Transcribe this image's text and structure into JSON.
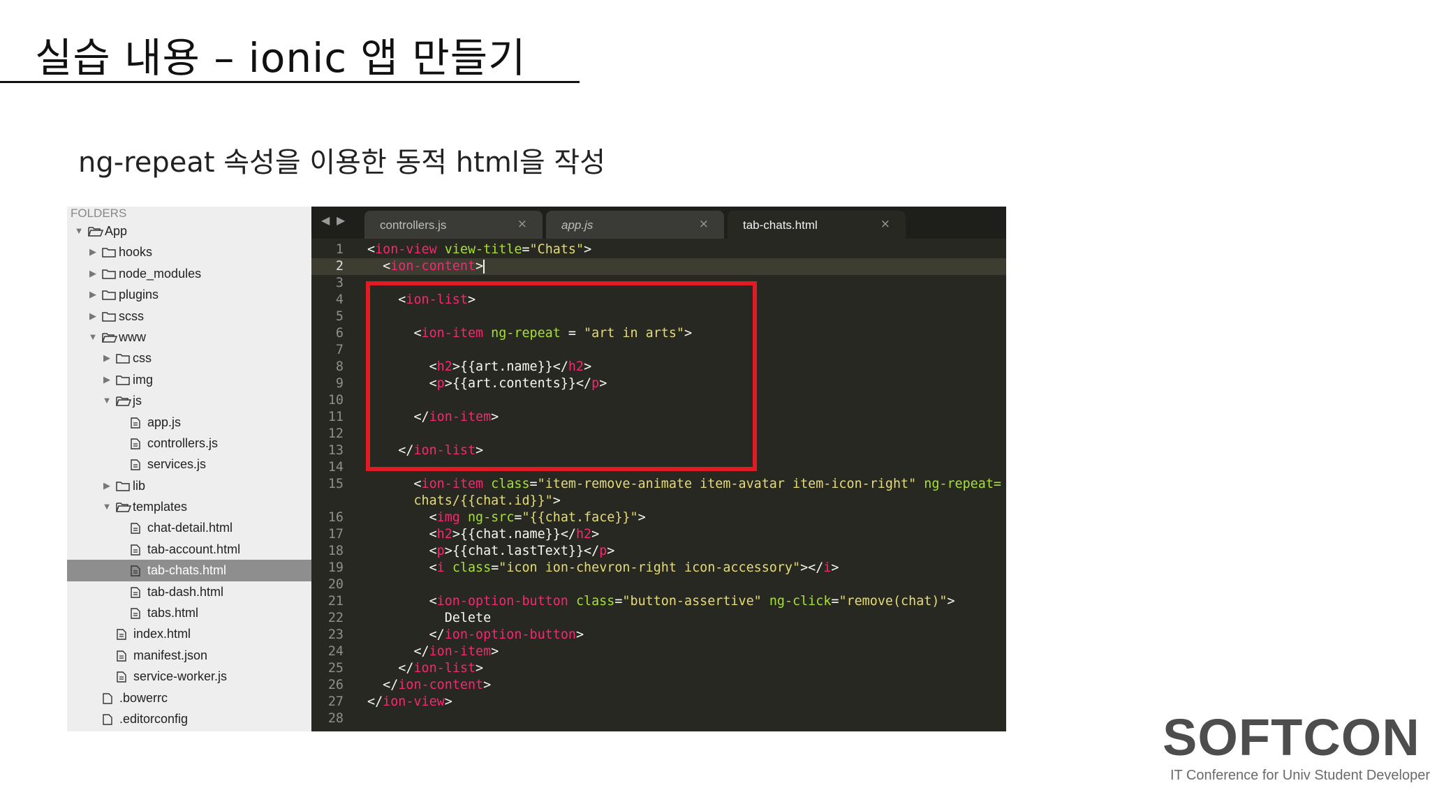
{
  "slide": {
    "title": "실습 내용 – ionic 앱 만들기",
    "subtitle": "ng-repeat 속성을 이용한 동적 html을 작성"
  },
  "sidebar": {
    "header": "FOLDERS",
    "items": [
      {
        "label": "App",
        "type": "folder",
        "open": true,
        "depth": 0
      },
      {
        "label": "hooks",
        "type": "folder",
        "open": false,
        "depth": 1
      },
      {
        "label": "node_modules",
        "type": "folder",
        "open": false,
        "depth": 1
      },
      {
        "label": "plugins",
        "type": "folder",
        "open": false,
        "depth": 1
      },
      {
        "label": "scss",
        "type": "folder",
        "open": false,
        "depth": 1
      },
      {
        "label": "www",
        "type": "folder",
        "open": true,
        "depth": 1
      },
      {
        "label": "css",
        "type": "folder",
        "open": false,
        "depth": 2
      },
      {
        "label": "img",
        "type": "folder",
        "open": false,
        "depth": 2
      },
      {
        "label": "js",
        "type": "folder",
        "open": true,
        "depth": 2
      },
      {
        "label": "app.js",
        "type": "file",
        "depth": 3
      },
      {
        "label": "controllers.js",
        "type": "file",
        "depth": 3
      },
      {
        "label": "services.js",
        "type": "file",
        "depth": 3
      },
      {
        "label": "lib",
        "type": "folder",
        "open": false,
        "depth": 2
      },
      {
        "label": "templates",
        "type": "folder",
        "open": true,
        "depth": 2
      },
      {
        "label": "chat-detail.html",
        "type": "file",
        "depth": 3
      },
      {
        "label": "tab-account.html",
        "type": "file",
        "depth": 3
      },
      {
        "label": "tab-chats.html",
        "type": "file",
        "depth": 3,
        "active": true
      },
      {
        "label": "tab-dash.html",
        "type": "file",
        "depth": 3
      },
      {
        "label": "tabs.html",
        "type": "file",
        "depth": 3
      },
      {
        "label": "index.html",
        "type": "file",
        "depth": 2
      },
      {
        "label": "manifest.json",
        "type": "file",
        "depth": 2
      },
      {
        "label": "service-worker.js",
        "type": "file",
        "depth": 2
      },
      {
        "label": ".bowerrc",
        "type": "plainfile",
        "depth": 1
      },
      {
        "label": ".editorconfig",
        "type": "plainfile",
        "depth": 1
      }
    ]
  },
  "editor": {
    "tabs": [
      {
        "label": "controllers.js",
        "active": false
      },
      {
        "label": "app.js",
        "active": false
      },
      {
        "label": "tab-chats.html",
        "active": true
      }
    ],
    "close_glyph": "×",
    "current_line": 2,
    "lines": [
      {
        "n": "1",
        "tokens": [
          [
            "br",
            "<"
          ],
          [
            "tag",
            "ion-view"
          ],
          [
            "txt",
            " "
          ],
          [
            "attr",
            "view-title"
          ],
          [
            "br",
            "="
          ],
          [
            "str",
            "\"Chats\""
          ],
          [
            "br",
            ">"
          ]
        ]
      },
      {
        "n": "2",
        "tokens": [
          [
            "txt",
            "  "
          ],
          [
            "br",
            "<"
          ],
          [
            "tag",
            "ion-content"
          ],
          [
            "br",
            ">"
          ]
        ],
        "cursor": true
      },
      {
        "n": "3",
        "tokens": []
      },
      {
        "n": "4",
        "tokens": [
          [
            "txt",
            "    "
          ],
          [
            "br",
            "<"
          ],
          [
            "tag",
            "ion-list"
          ],
          [
            "br",
            ">"
          ]
        ]
      },
      {
        "n": "5",
        "tokens": []
      },
      {
        "n": "6",
        "tokens": [
          [
            "txt",
            "      "
          ],
          [
            "br",
            "<"
          ],
          [
            "tag",
            "ion-item"
          ],
          [
            "txt",
            " "
          ],
          [
            "attr",
            "ng-repeat"
          ],
          [
            "txt",
            " = "
          ],
          [
            "str",
            "\"art in arts\""
          ],
          [
            "br",
            ">"
          ]
        ]
      },
      {
        "n": "7",
        "tokens": []
      },
      {
        "n": "8",
        "tokens": [
          [
            "txt",
            "        "
          ],
          [
            "br",
            "<"
          ],
          [
            "tag",
            "h2"
          ],
          [
            "br",
            ">"
          ],
          [
            "txt",
            "{{art.name}}"
          ],
          [
            "br",
            "</"
          ],
          [
            "tag",
            "h2"
          ],
          [
            "br",
            ">"
          ]
        ]
      },
      {
        "n": "9",
        "tokens": [
          [
            "txt",
            "        "
          ],
          [
            "br",
            "<"
          ],
          [
            "tag",
            "p"
          ],
          [
            "br",
            ">"
          ],
          [
            "txt",
            "{{art.contents}}"
          ],
          [
            "br",
            "</"
          ],
          [
            "tag",
            "p"
          ],
          [
            "br",
            ">"
          ]
        ]
      },
      {
        "n": "10",
        "tokens": []
      },
      {
        "n": "11",
        "tokens": [
          [
            "txt",
            "      "
          ],
          [
            "br",
            "</"
          ],
          [
            "tag",
            "ion-item"
          ],
          [
            "br",
            ">"
          ]
        ]
      },
      {
        "n": "12",
        "tokens": []
      },
      {
        "n": "13",
        "tokens": [
          [
            "txt",
            "    "
          ],
          [
            "br",
            "</"
          ],
          [
            "tag",
            "ion-list"
          ],
          [
            "br",
            ">"
          ]
        ]
      },
      {
        "n": "14",
        "tokens": []
      },
      {
        "n": "15",
        "tokens": [
          [
            "txt",
            "      "
          ],
          [
            "br",
            "<"
          ],
          [
            "tag",
            "ion-item"
          ],
          [
            "txt",
            " "
          ],
          [
            "attr",
            "class"
          ],
          [
            "br",
            "="
          ],
          [
            "str",
            "\"item-remove-animate item-avatar item-icon-right\""
          ],
          [
            "txt",
            " "
          ],
          [
            "attr",
            "ng-repeat="
          ]
        ]
      },
      {
        "n": "",
        "tokens": [
          [
            "txt",
            "      "
          ],
          [
            "str",
            "chats/{{chat.id}}\""
          ],
          [
            "br",
            ">"
          ]
        ]
      },
      {
        "n": "16",
        "tokens": [
          [
            "txt",
            "        "
          ],
          [
            "br",
            "<"
          ],
          [
            "tag",
            "img"
          ],
          [
            "txt",
            " "
          ],
          [
            "attr",
            "ng-src"
          ],
          [
            "br",
            "="
          ],
          [
            "str",
            "\"{{chat.face}}\""
          ],
          [
            "br",
            ">"
          ]
        ]
      },
      {
        "n": "17",
        "tokens": [
          [
            "txt",
            "        "
          ],
          [
            "br",
            "<"
          ],
          [
            "tag",
            "h2"
          ],
          [
            "br",
            ">"
          ],
          [
            "txt",
            "{{chat.name}}"
          ],
          [
            "br",
            "</"
          ],
          [
            "tag",
            "h2"
          ],
          [
            "br",
            ">"
          ]
        ]
      },
      {
        "n": "18",
        "tokens": [
          [
            "txt",
            "        "
          ],
          [
            "br",
            "<"
          ],
          [
            "tag",
            "p"
          ],
          [
            "br",
            ">"
          ],
          [
            "txt",
            "{{chat.lastText}}"
          ],
          [
            "br",
            "</"
          ],
          [
            "tag",
            "p"
          ],
          [
            "br",
            ">"
          ]
        ]
      },
      {
        "n": "19",
        "tokens": [
          [
            "txt",
            "        "
          ],
          [
            "br",
            "<"
          ],
          [
            "tag",
            "i"
          ],
          [
            "txt",
            " "
          ],
          [
            "attr",
            "class"
          ],
          [
            "br",
            "="
          ],
          [
            "str",
            "\"icon ion-chevron-right icon-accessory\""
          ],
          [
            "br",
            "></"
          ],
          [
            "tag",
            "i"
          ],
          [
            "br",
            ">"
          ]
        ]
      },
      {
        "n": "20",
        "tokens": []
      },
      {
        "n": "21",
        "tokens": [
          [
            "txt",
            "        "
          ],
          [
            "br",
            "<"
          ],
          [
            "tag",
            "ion-option-button"
          ],
          [
            "txt",
            " "
          ],
          [
            "attr",
            "class"
          ],
          [
            "br",
            "="
          ],
          [
            "str",
            "\"button-assertive\""
          ],
          [
            "txt",
            " "
          ],
          [
            "attr",
            "ng-click"
          ],
          [
            "br",
            "="
          ],
          [
            "str",
            "\"remove(chat)\""
          ],
          [
            "br",
            ">"
          ]
        ]
      },
      {
        "n": "22",
        "tokens": [
          [
            "txt",
            "          Delete"
          ]
        ]
      },
      {
        "n": "23",
        "tokens": [
          [
            "txt",
            "        "
          ],
          [
            "br",
            "</"
          ],
          [
            "tag",
            "ion-option-button"
          ],
          [
            "br",
            ">"
          ]
        ]
      },
      {
        "n": "24",
        "tokens": [
          [
            "txt",
            "      "
          ],
          [
            "br",
            "</"
          ],
          [
            "tag",
            "ion-item"
          ],
          [
            "br",
            ">"
          ]
        ]
      },
      {
        "n": "25",
        "tokens": [
          [
            "txt",
            "    "
          ],
          [
            "br",
            "</"
          ],
          [
            "tag",
            "ion-list"
          ],
          [
            "br",
            ">"
          ]
        ]
      },
      {
        "n": "26",
        "tokens": [
          [
            "txt",
            "  "
          ],
          [
            "br",
            "</"
          ],
          [
            "tag",
            "ion-content"
          ],
          [
            "br",
            ">"
          ]
        ]
      },
      {
        "n": "27",
        "tokens": [
          [
            "br",
            "</"
          ],
          [
            "tag",
            "ion-view"
          ],
          [
            "br",
            ">"
          ]
        ]
      },
      {
        "n": "28",
        "tokens": []
      }
    ]
  },
  "colors": {
    "editor_bg": "#272822",
    "tag": "#f92672",
    "attr": "#a6e22e",
    "string": "#e6db74",
    "highlight_box": "#e01b24",
    "sidebar_active": "#8e8e8e"
  },
  "icons": {
    "folder_closed": "folder-icon",
    "folder_open": "folder-open-icon",
    "file": "file-icon",
    "expand": "triangle-right-icon",
    "collapse": "triangle-down-icon"
  },
  "brand": {
    "name": "SOFTCON",
    "tagline": "IT Conference for Univ Student Developer"
  }
}
